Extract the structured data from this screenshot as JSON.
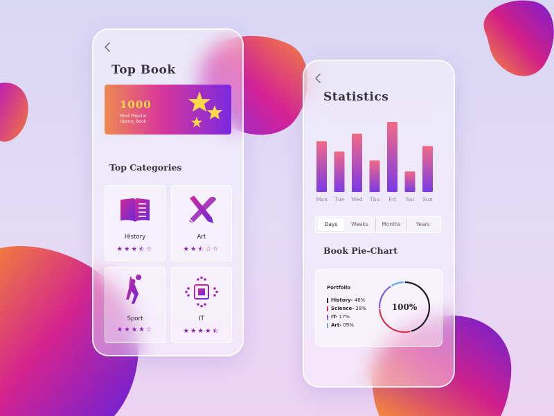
{
  "left_phone": {
    "title": "Top Book",
    "banner": {
      "number": "1000",
      "subtitle_line1": "Most Popular",
      "subtitle_line2": "History Book"
    },
    "section_title": "Top Categories",
    "categories": [
      {
        "label": "History",
        "rating": 3.5,
        "stars_text": "★★★⯪☆",
        "icon": "book-icon"
      },
      {
        "label": "Art",
        "rating": 2.5,
        "stars_text": "★★⯪☆☆",
        "icon": "brush-pencil-icon"
      },
      {
        "label": "Sport",
        "rating": 4,
        "stars_text": "★★★★☆",
        "icon": "volleyball-player-icon"
      },
      {
        "label": "IT",
        "rating": 4.5,
        "stars_text": "★★★★⯪",
        "icon": "circuit-chip-icon"
      }
    ]
  },
  "right_phone": {
    "title": "Statistics",
    "chart_data": {
      "type": "bar",
      "categories": [
        "Mon",
        "Tue",
        "Wed",
        "Thu",
        "Fri",
        "Sat",
        "Sun"
      ],
      "values": [
        74,
        59,
        85,
        46,
        102,
        30,
        67
      ],
      "colors": {
        "top": "#f06a86",
        "bottom": "#7b3ae6"
      }
    },
    "tabs": [
      "Days",
      "Weeks",
      "Months",
      "Years"
    ],
    "active_tab": "Days",
    "pie_section_title": "Book Pie-Chart",
    "pie": {
      "heading": "Portfolio",
      "center_label": "100%",
      "items": [
        {
          "label": "History",
          "value_text": "46%",
          "value": 46,
          "color": "#1d1a24"
        },
        {
          "label": "Science",
          "value_text": "28%",
          "value": 28,
          "color": "#d8304a"
        },
        {
          "label": "IT",
          "value_text": "17%",
          "value": 17,
          "color": "#7b5ae8"
        },
        {
          "label": "Art",
          "value_text": "09%",
          "value": 9,
          "color": "#6aa8f0"
        }
      ]
    }
  },
  "colors": {
    "accent": "#8b1fb3",
    "banner_start": "#ee8a52",
    "banner_end": "#7b2ae2"
  }
}
